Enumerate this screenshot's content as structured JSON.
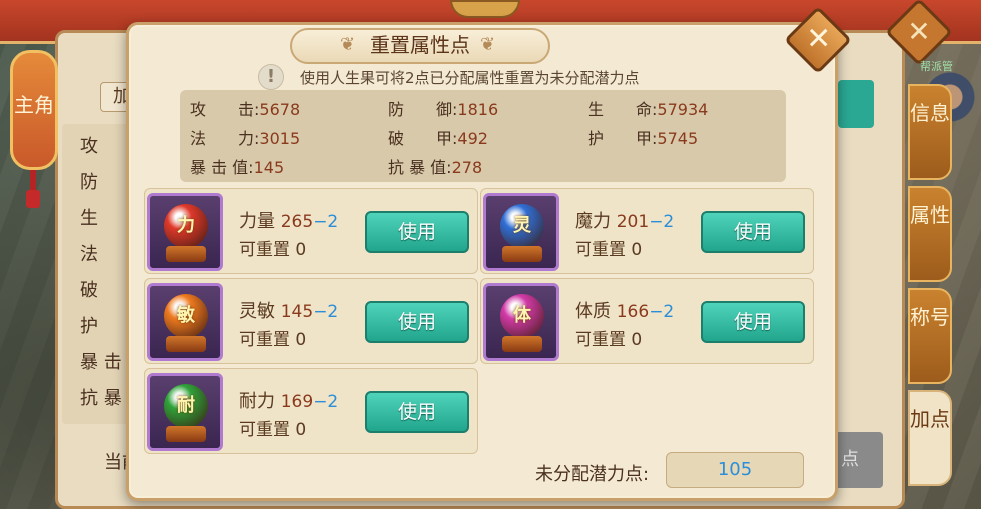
{
  "background": {
    "lantern_label": "主角",
    "tab_button_label": "加",
    "attribute_list": [
      "攻",
      "防",
      "生",
      "法",
      "破",
      "护",
      "暴 击",
      "抗 暴"
    ],
    "current_label": "当前",
    "point_button_label": "点",
    "npc_name": "帮派管"
  },
  "side_tabs": [
    {
      "label": "信息"
    },
    {
      "label": "属性"
    },
    {
      "label": "称号"
    },
    {
      "label": "加点"
    }
  ],
  "dialog": {
    "title": "重置属性点",
    "hint": "使用人生果可将2点已分配属性重置为未分配潜力点",
    "close_icon": "close-x",
    "stats": [
      {
        "label": "攻　　击:",
        "value": "5678"
      },
      {
        "label": "防　　御:",
        "value": "1816"
      },
      {
        "label": "生　　命:",
        "value": "57934"
      },
      {
        "label": "法　　力:",
        "value": "3015"
      },
      {
        "label": "破　　甲:",
        "value": "492"
      },
      {
        "label": "护　　甲:",
        "value": "5745"
      },
      {
        "label": "暴 击 值:",
        "value": "145"
      },
      {
        "label": "抗 暴 值:",
        "value": "278"
      }
    ],
    "attributes": [
      {
        "glyph": "力",
        "name": "力量",
        "value": "265",
        "delta": "−2",
        "reset_label": "可重置",
        "reset_value": "0",
        "button": "使用",
        "orb_color": "#e0392a"
      },
      {
        "glyph": "灵",
        "name": "魔力",
        "value": "201",
        "delta": "−2",
        "reset_label": "可重置",
        "reset_value": "0",
        "button": "使用",
        "orb_color": "#2f6fd6"
      },
      {
        "glyph": "敏",
        "name": "灵敏",
        "value": "145",
        "delta": "−2",
        "reset_label": "可重置",
        "reset_value": "0",
        "button": "使用",
        "orb_color": "#ef7a1f"
      },
      {
        "glyph": "体",
        "name": "体质",
        "value": "166",
        "delta": "−2",
        "reset_label": "可重置",
        "reset_value": "0",
        "button": "使用",
        "orb_color": "#d23aa8"
      },
      {
        "glyph": "耐",
        "name": "耐力",
        "value": "169",
        "delta": "−2",
        "reset_label": "可重置",
        "reset_value": "0",
        "button": "使用",
        "orb_color": "#2fa33a"
      }
    ],
    "unallocated_label": "未分配潜力点:",
    "unallocated_value": "105"
  }
}
